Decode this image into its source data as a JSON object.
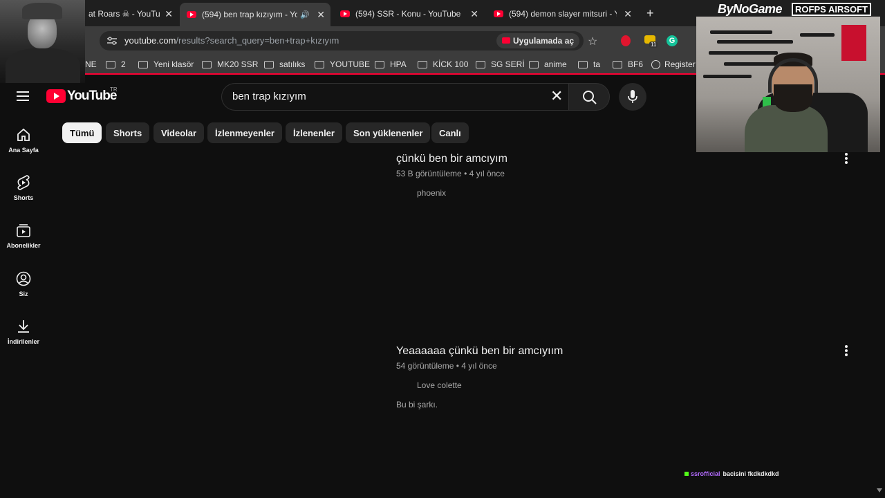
{
  "browser": {
    "tabs": [
      {
        "title": "at Roars ☠ - YouTu",
        "active": false,
        "icon": "skull-icon"
      },
      {
        "title": "(594) ben trap kızıyım - You",
        "active": true,
        "icon": "youtube-icon"
      },
      {
        "title": "(594) SSR - Konu - YouTube",
        "active": false,
        "icon": "youtube-icon"
      },
      {
        "title": "(594) demon slayer mitsuri - Yo",
        "active": false,
        "icon": "youtube-icon"
      }
    ],
    "url_host": "youtube.com",
    "url_path": "/results?search_query=ben+trap+kızıyım",
    "open_in_app": "Uygulamada aç",
    "extension_badge": "11",
    "bookmarks": [
      "NE",
      "2",
      "Yeni klasör",
      "MK20 SSR",
      "satılıks",
      "YOUTUBE",
      "HPA",
      "KİCK 100",
      "SG SERİ",
      "anime",
      "ta",
      "BF6",
      "Register"
    ]
  },
  "youtube": {
    "logo_text": "YouTube",
    "country_code": "TR",
    "search_query": "ben trap kızıyım",
    "chips": [
      {
        "label": "Tümü",
        "active": true
      },
      {
        "label": "Shorts",
        "active": false
      },
      {
        "label": "Videolar",
        "active": false
      },
      {
        "label": "İzlenmeyenler",
        "active": false
      },
      {
        "label": "İzlenenler",
        "active": false
      },
      {
        "label": "Son yüklenenler",
        "active": false
      },
      {
        "label": "Canlı",
        "active": false
      }
    ],
    "sidebar": [
      {
        "label": "Ana Sayfa",
        "icon": "home-icon"
      },
      {
        "label": "Shorts",
        "icon": "shorts-icon"
      },
      {
        "label": "Abonelikler",
        "icon": "subscriptions-icon"
      },
      {
        "label": "Siz",
        "icon": "account-icon"
      },
      {
        "label": "İndirilenler",
        "icon": "download-icon"
      }
    ],
    "results": [
      {
        "title": "çünkü ben bir amcıyım",
        "views": "53 B görüntüleme",
        "age": "4 yıl önce",
        "channel": "phoenix",
        "description": ""
      },
      {
        "title": "Yeaaaaaa çünkü ben bir amcıyıım",
        "views": "54 görüntüleme",
        "age": "4 yıl önce",
        "channel": "Love colette",
        "description": "Bu bi şarkı."
      }
    ]
  },
  "overlay": {
    "sponsor_1": "ByNoGame",
    "sponsor_2": "ROFPS AIRSOFT",
    "chat_user": "ssrofficial",
    "chat_message": "bacisini fkdkdkdkd"
  },
  "colors": {
    "youtube_red": "#ff0033",
    "background": "#0f0f0f",
    "chip_bg": "#272727",
    "chat_user": "#b46cff",
    "kick_green": "#53fc18"
  }
}
